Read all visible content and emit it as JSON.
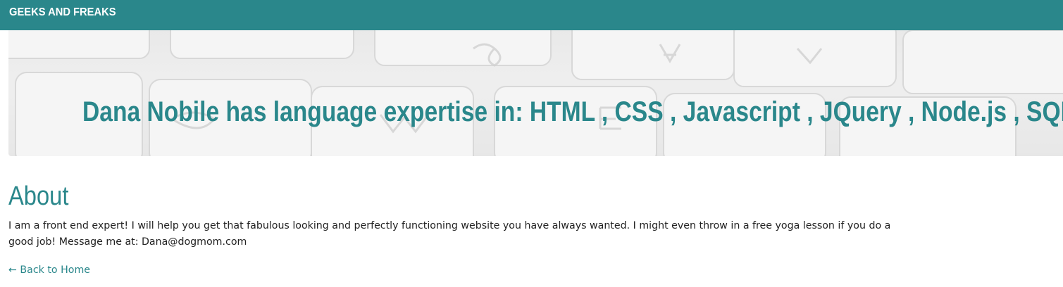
{
  "navbar": {
    "brand": "GEEKS AND FREAKS",
    "color": "#2a878b"
  },
  "hero": {
    "headline": "Dana Nobile has language expertise in: HTML , CSS , Javascript , JQuery , Node.js , SQL",
    "background": "keyboard-photo"
  },
  "about": {
    "heading": "About",
    "body": "I am a front end expert! I will help you get that fabulous looking and perfectly functioning website you have always wanted. I might even throw in a free yoga lesson if you do a good job! Message me at: Dana@dogmom.com"
  },
  "links": {
    "back": "← Back to Home"
  },
  "colors": {
    "accent": "#2a878b",
    "text": "#222222"
  }
}
